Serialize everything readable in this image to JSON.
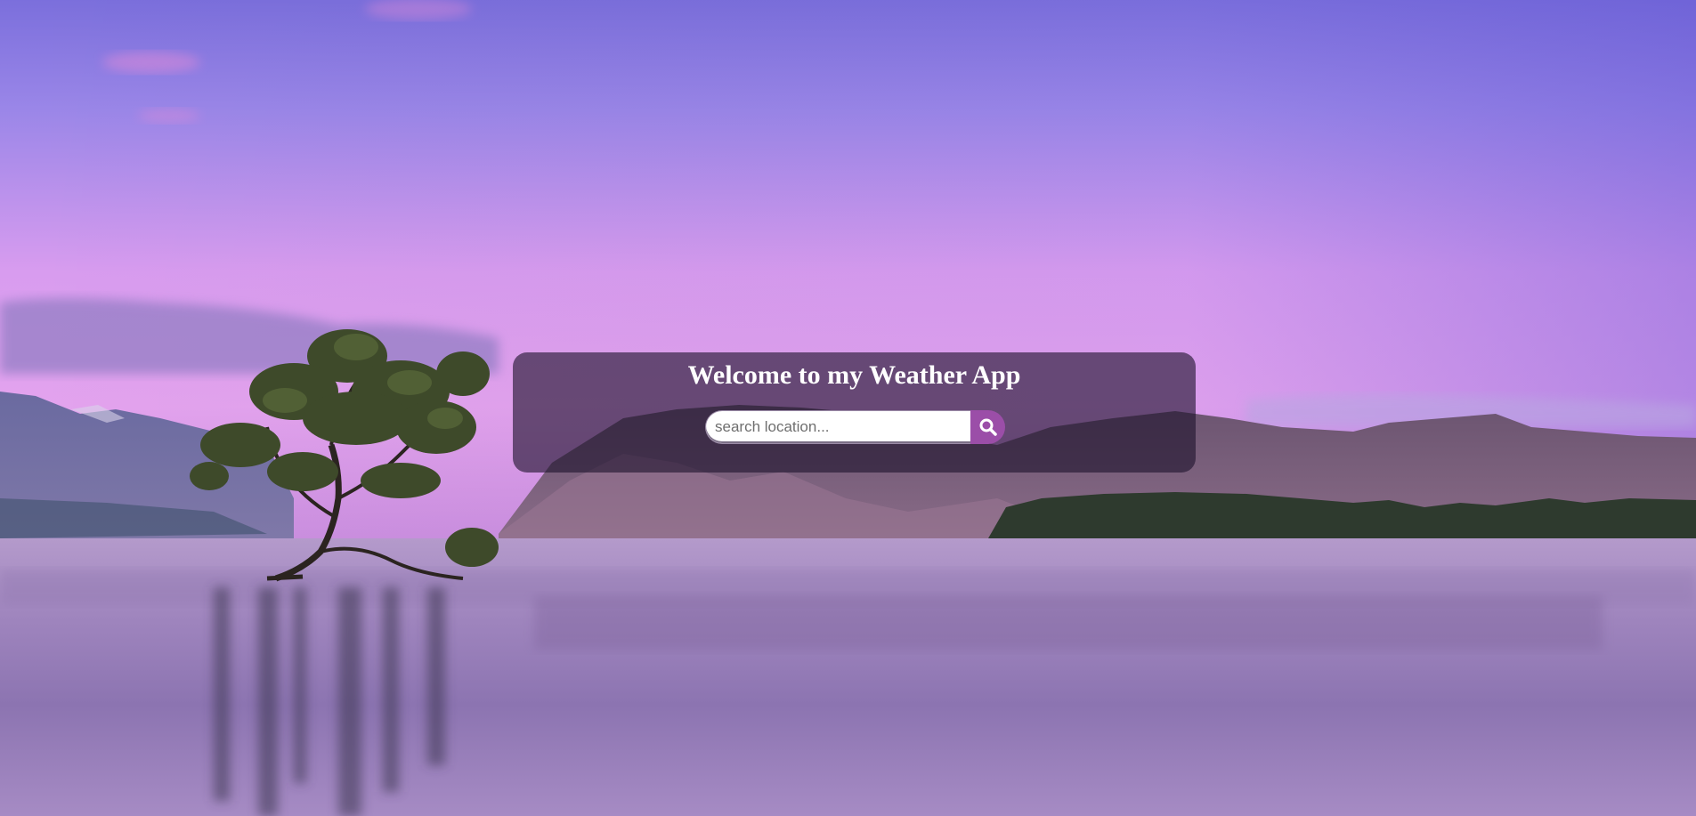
{
  "header": {
    "title": "Welcome to my Weather App"
  },
  "search": {
    "placeholder": "search location...",
    "value": "",
    "button_icon": "search-icon"
  },
  "colors": {
    "panel_background": "#1e142d",
    "search_button": "#9b4ea8",
    "title_text": "#ffffff"
  },
  "background": {
    "description_icon": "lake-landscape-background"
  }
}
